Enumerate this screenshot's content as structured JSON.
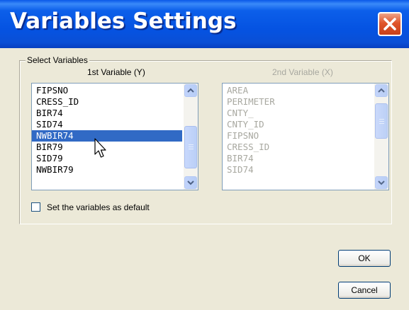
{
  "window": {
    "title": "Variables Settings"
  },
  "group": {
    "label": "Select Variables"
  },
  "list1": {
    "caption": "1st Variable (Y)",
    "items": [
      "FIPSNO",
      "CRESS_ID",
      "BIR74",
      "SID74",
      "NWBIR74",
      "BIR79",
      "SID79",
      "NWBIR79"
    ],
    "selected": "NWBIR74"
  },
  "list2": {
    "caption": "2nd Variable (X)",
    "items": [
      "AREA",
      "PERIMETER",
      "CNTY_",
      "CNTY_ID",
      "FIPSNO",
      "CRESS_ID",
      "BIR74",
      "SID74"
    ],
    "enabled": false
  },
  "checkbox": {
    "label": "Set the variables as default",
    "checked": false
  },
  "buttons": {
    "ok": "OK",
    "cancel": "Cancel"
  },
  "icons": {
    "close": "close-icon",
    "scroll_up": "chevron-up-icon",
    "scroll_down": "chevron-down-icon",
    "cursor": "mouse-pointer-icon"
  },
  "colors": {
    "titlebar": "#0553E2",
    "selection": "#316AC5",
    "close": "#E0552A",
    "dialog": "#ECE9D8"
  }
}
